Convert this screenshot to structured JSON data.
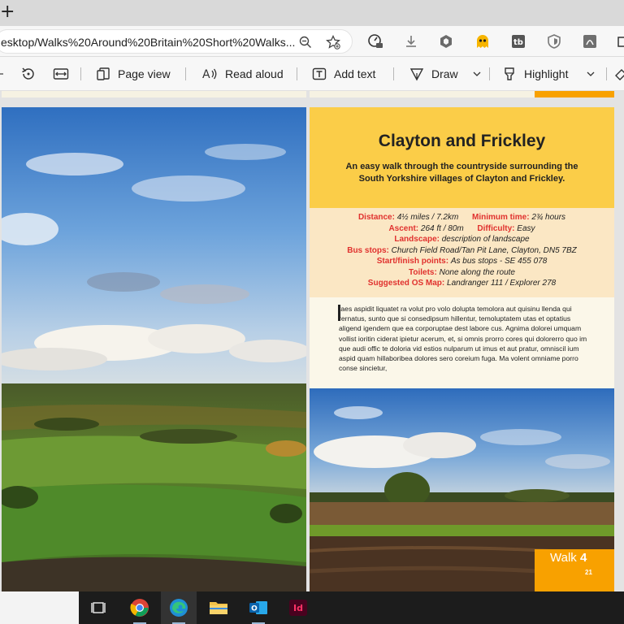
{
  "browser": {
    "url": "esktop/Walks%20Around%20Britain%20Short%20Walks...",
    "extensions": [
      "speed-icon",
      "download-icon",
      "cube-icon",
      "pacman-icon",
      "tb-icon",
      "shield-icon",
      "pdf-icon",
      "puzzle-icon"
    ]
  },
  "pdf_toolbar": {
    "page_view": "Page view",
    "read_aloud": "Read aloud",
    "add_text": "Add text",
    "draw": "Draw",
    "highlight": "Highlight"
  },
  "walk": {
    "title": "Clayton and Frickley",
    "subtitle": "An easy walk through the countryside surrounding the South Yorkshire villages of Clayton and Frickley.",
    "info": {
      "distance_label": "Distance:",
      "distance_value": "4½ miles / 7.2km",
      "min_time_label": "Minimum time:",
      "min_time_value": "2¾ hours",
      "ascent_label": "Ascent:",
      "ascent_value": "264 ft / 80m",
      "difficulty_label": "Difficulty:",
      "difficulty_value": "Easy",
      "landscape_label": "Landscape:",
      "landscape_value": "description of landscape",
      "bus_label": "Bus stops:",
      "bus_value": "Church Field Road/Tan Pit Lane, Clayton, DN5 7BZ",
      "startfinish_label": "Start/finish points:",
      "startfinish_value": "As bus stops - SE 455 078",
      "toilets_label": "Toilets:",
      "toilets_value": "None along the route",
      "osmap_label": "Suggested OS Map:",
      "osmap_value": "Landranger 111 / Explorer 278"
    },
    "body_text": "taes aspidit liquatet ra volut pro volo dolupta temolora aut quisinu llenda qui rernatus, sunto que si consedipsum hillentur, temoluptatem utas et optatius aligend igendem que ea corporuptae dest labore cus. Agnima dolorei umquam vollist ioritin ciderat ipietur acerum, et, si omnis prorro cores qui dolorerro quo im que audi offic te doloria vid estios nulparum ut imus et aut pratur, omniscil ium aspid quam hillaboribea dolores sero coreium fuga. Ma volent omniame porro conse sincietur,",
    "walk_label": "Walk",
    "walk_number": "4",
    "page_number": "21"
  },
  "colors": {
    "title_yellow": "#fbcd48",
    "info_peach": "#fbe7c4",
    "label_red": "#e0312e",
    "walk_orange": "#f8a100"
  },
  "taskbar": {
    "apps": [
      "task-view-icon",
      "chrome-icon",
      "edge-icon",
      "file-explorer-icon",
      "outlook-icon",
      "indesign-icon"
    ],
    "indesign_text": "Id",
    "outlook_text": "O"
  }
}
